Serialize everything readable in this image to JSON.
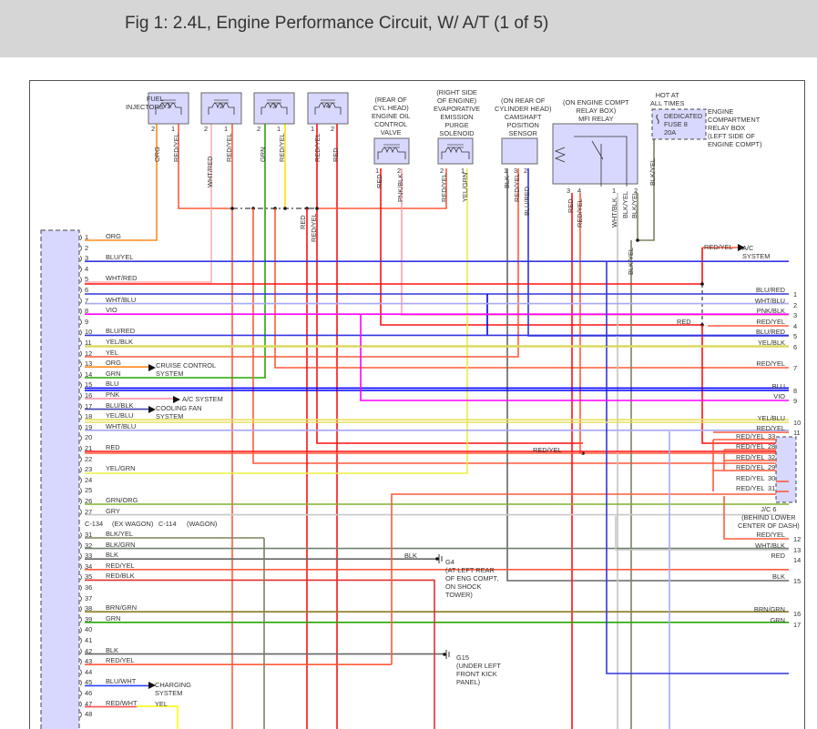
{
  "title": "Fig 1: 2.4L, Engine Performance Circuit, W/ A/T (1 of 5)",
  "components": {
    "fuel_injectors": {
      "label": "FUEL\nINJECTORS",
      "units": [
        {
          "num": "1",
          "pin_a": "2",
          "pin_b": "1",
          "wire_a": "ORG",
          "wire_b": "RED/YEL"
        },
        {
          "num": "2",
          "pin_a": "2",
          "pin_b": "1",
          "wire_a": "WHT/RED",
          "wire_b": "RED/YEL"
        },
        {
          "num": "3",
          "pin_a": "2",
          "pin_b": "1",
          "wire_a": "GRN",
          "wire_b": "RED/YEL"
        },
        {
          "num": "4",
          "pin_a": "1",
          "pin_b": "2",
          "wire_a": "RED/YEL",
          "wire_b": "RED"
        }
      ]
    },
    "oil_valve": {
      "label": "(REAR OF\nCYL HEAD)\nENGINE OIL\nCONTROL\nVALVE",
      "pins": [
        "1",
        "2"
      ],
      "wires": [
        "RED",
        "PNK/BLK"
      ]
    },
    "purge": {
      "label": "(RIGHT SIDE\nOF ENGINE)\nEVAPORATIVE\nEMISSION\nPURGE\nSOLENOID",
      "pins": [
        "2",
        "1"
      ],
      "wires": [
        "RED/YEL",
        "YEL/GRN"
      ]
    },
    "cmp": {
      "label": "(ON REAR OF\nCYLINDER HEAD)\nCAMSHAFT\nPOSITION\nSENSOR",
      "pins": [
        "1",
        "3",
        "2"
      ],
      "wires": [
        "BLK",
        "RED/YEL",
        "BLU/RED"
      ]
    },
    "relay": {
      "label": "(ON ENGINE COMPT\nRELAY BOX)\nMFI RELAY",
      "pins": [
        "3",
        "4",
        "1",
        "2"
      ],
      "wires": [
        "RED",
        "RED/YEL",
        "WHT/BLK",
        "BLK/YEL",
        "BLK/YEL"
      ]
    },
    "fuse": {
      "hot": "HOT AT\nALL TIMES",
      "label": "DEDICATED\nFUSE 8\n20A",
      "box": "ENGINE\nCOMPARTMENT\nRELAY BOX\n(LEFT SIDE OF\nENGINE COMPT)",
      "wire": "BLK/YEL",
      "wire2": "BLK/YEL"
    }
  },
  "splice_labels": [
    "RED",
    "RED/YEL"
  ],
  "left_connector": {
    "c134": "C-134",
    "ex_wagon": "(EX WAGON)",
    "c114": "C-114",
    "wagon": "(WAGON)",
    "pins": [
      {
        "n": "1",
        "w": "ORG"
      },
      {
        "n": "2",
        "w": ""
      },
      {
        "n": "3",
        "w": "BLU/YEL"
      },
      {
        "n": "4",
        "w": ""
      },
      {
        "n": "5",
        "w": "WHT/RED"
      },
      {
        "n": "6",
        "w": ""
      },
      {
        "n": "7",
        "w": "WHT/BLU"
      },
      {
        "n": "8",
        "w": "VIO"
      },
      {
        "n": "9",
        "w": ""
      },
      {
        "n": "10",
        "w": "BLU/RED"
      },
      {
        "n": "11",
        "w": "YEL/BLK"
      },
      {
        "n": "12",
        "w": "YEL"
      },
      {
        "n": "13",
        "w": "ORG"
      },
      {
        "n": "14",
        "w": "GRN"
      },
      {
        "n": "15",
        "w": "BLU"
      },
      {
        "n": "16",
        "w": "PNK"
      },
      {
        "n": "17",
        "w": "BLU/BLK"
      },
      {
        "n": "18",
        "w": "YEL/BLU"
      },
      {
        "n": "19",
        "w": "WHT/BLU"
      },
      {
        "n": "20",
        "w": ""
      },
      {
        "n": "21",
        "w": "RED"
      },
      {
        "n": "22",
        "w": ""
      },
      {
        "n": "23",
        "w": "YEL/GRN"
      },
      {
        "n": "24",
        "w": ""
      },
      {
        "n": "25",
        "w": ""
      },
      {
        "n": "26",
        "w": "GRN/ORG"
      },
      {
        "n": "27",
        "w": "GRY"
      },
      {
        "n": "31",
        "w": "BLK/YEL"
      },
      {
        "n": "32",
        "w": "BLK/GRN"
      },
      {
        "n": "33",
        "w": "BLK"
      },
      {
        "n": "34",
        "w": "RED/YEL"
      },
      {
        "n": "35",
        "w": "RED/BLK"
      },
      {
        "n": "36",
        "w": ""
      },
      {
        "n": "37",
        "w": ""
      },
      {
        "n": "38",
        "w": "BRN/GRN"
      },
      {
        "n": "39",
        "w": "GRN"
      },
      {
        "n": "40",
        "w": ""
      },
      {
        "n": "41",
        "w": ""
      },
      {
        "n": "42",
        "w": "BLK"
      },
      {
        "n": "43",
        "w": "RED/YEL"
      },
      {
        "n": "44",
        "w": ""
      },
      {
        "n": "45",
        "w": "BLU/WHT"
      },
      {
        "n": "46",
        "w": ""
      },
      {
        "n": "47",
        "w": "RED/WHT"
      },
      {
        "n": "48",
        "w": ""
      }
    ]
  },
  "destinations": {
    "cruise": "CRUISE CONTROL\nSYSTEM",
    "ac": "A/C SYSTEM",
    "fan": "COOLING FAN\nSYSTEM",
    "charging": "CHARGING\nSYSTEM",
    "yel": "YEL",
    "ac_right": "A/C\nSYSTEM",
    "ac_right_wire": "RED/YEL"
  },
  "grounds": {
    "g4_wire": "BLK",
    "g4": "G4\n(AT LEFT REAR\nOF ENG COMPT,\nON SHOCK\nTOWER)",
    "g15": "G15\n(UNDER LEFT\nFRONT KICK\nPANEL)"
  },
  "mid_labels": {
    "red_yel": "RED/YEL",
    "red": "RED"
  },
  "right_pins": [
    {
      "n": "1",
      "w": "BLU/RED"
    },
    {
      "n": "2",
      "w": "WHT/BLU"
    },
    {
      "n": "3",
      "w": "PNK/BLK"
    },
    {
      "n": "4",
      "w": "RED/YEL"
    },
    {
      "n": "5",
      "w": "BLU/RED"
    },
    {
      "n": "6",
      "w": "YEL/BLK"
    },
    {
      "n": "7",
      "w": "RED/YEL"
    },
    {
      "n": "8",
      "w": "BLU"
    },
    {
      "n": "9",
      "w": "VIO"
    },
    {
      "n": "10",
      "w": "YEL/BLU"
    },
    {
      "n": "11",
      "w": "RED/YEL"
    },
    {
      "n": "12",
      "w": "RED/YEL"
    },
    {
      "n": "13",
      "w": "WHT/BLK"
    },
    {
      "n": "14",
      "w": "RED"
    },
    {
      "n": "15",
      "w": "BLK"
    },
    {
      "n": "16",
      "w": "BRN/GRN"
    },
    {
      "n": "17",
      "w": "GRN"
    }
  ],
  "jc6": {
    "label": "J/C 6\n(BEHIND LOWER\nCENTER OF DASH)",
    "pins": [
      {
        "n": "33",
        "w": "RED/YEL"
      },
      {
        "n": "28",
        "w": "RED/YEL"
      },
      {
        "n": "32",
        "w": "RED/YEL"
      },
      {
        "n": "29",
        "w": "RED/YEL"
      },
      {
        "n": "30",
        "w": "RED/YEL"
      },
      {
        "n": "31",
        "w": "RED/YEL"
      }
    ]
  },
  "wire_colors": {
    "ORG": "#ff8a1e",
    "RED": "#ff1010",
    "RED/YEL": "#ff5a3c",
    "WHT/RED": "#ffb0b0",
    "GRN": "#22a800",
    "BLU/YEL": "#3434e0",
    "WHT/BLU": "#a8a8f0",
    "VIO": "#ff00ff",
    "BLU/RED": "#3434e0",
    "YEL/BLK": "#dada60",
    "YEL": "#ffff00",
    "BLU": "#0000ff",
    "PNK": "#ff8aa0",
    "BLU/BLK": "#4040b0",
    "YEL/BLU": "#e6e060",
    "GRN/ORG": "#80b030",
    "GRY": "#c8c8c8",
    "BLK/YEL": "#808060",
    "BLK/GRN": "#708070",
    "BLK": "#666666",
    "RED/BLK": "#e03030",
    "BRN/GRN": "#8a7a20",
    "BLU/WHT": "#2a40ff",
    "RED/WHT": "#ff5050",
    "PNK/BLK": "#ffa0b0",
    "YEL/GRN": "#e8f040",
    "WHT/BLK": "#c4c4c4"
  }
}
